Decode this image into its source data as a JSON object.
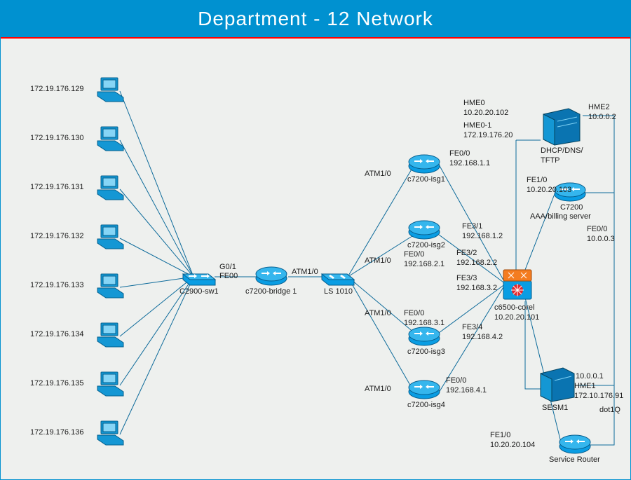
{
  "title": "Department - 12 Network",
  "workstations": [
    {
      "ip": "172.19.176.129"
    },
    {
      "ip": "172.19.176.130"
    },
    {
      "ip": "172.19.176.131"
    },
    {
      "ip": "172.19.176.132"
    },
    {
      "ip": "172.19.176.133"
    },
    {
      "ip": "172.19.176.134"
    },
    {
      "ip": "172.19.176.135"
    },
    {
      "ip": "172.19.176.136"
    }
  ],
  "devices": {
    "c2900": "C2900-sw1",
    "c7200bridge": "c7200-bridge 1",
    "ls1010": "LS 1010",
    "isg1": "c7200-isg1",
    "isg2": "c7200-isg2",
    "isg3": "c7200-isg3",
    "isg4": "c7200-isg4",
    "c6500": "c6500-corel",
    "c6500_ip": "10.20.20.101",
    "dhcp": "DHCP/DNS/\nTFTP",
    "c7200aaa": "C7200",
    "aaa_sub": "AAA/billing server",
    "sesm1": "SESM1",
    "service_router": "Service Router"
  },
  "links": {
    "g01": "G0/1",
    "fe00": "FE00",
    "atm10_a": "ATM1/0",
    "atm10_1": "ATM1/0",
    "atm10_2": "ATM1/0",
    "atm10_3": "ATM1/0",
    "atm10_4": "ATM1/0",
    "fe00_1": "FE0/0\n192.168.1.1",
    "fe00_2": "FE0/0\n192.168.2.1",
    "fe00_3": "FE0/0\n192.168.3.1",
    "fe00_4": "FE0/0\n192.168.4.1",
    "fe31": "FE3/1\n192.168.1.2",
    "fe32": "FE3/2\n192.168.2.2",
    "fe33": "FE3/3\n192.168.3.2",
    "fe34": "FE3/4\n192.168.4.2",
    "hme0": "HME0\n10.20.20.102",
    "hme01": "HME0-1\n172.19.176.20",
    "hme2": "HME2\n10.0.0.2",
    "fe10_103": "FE1/0\n10.20.20.103",
    "fe00_1003": "FE0/0\n10.0.0.3",
    "sesm_10001": "10.0.0.1",
    "sesm_hme1": "HME1\n172.10.176.91",
    "dot1q": "dot1Q",
    "fe10_104": "FE1/0\n10.20.20.104"
  }
}
